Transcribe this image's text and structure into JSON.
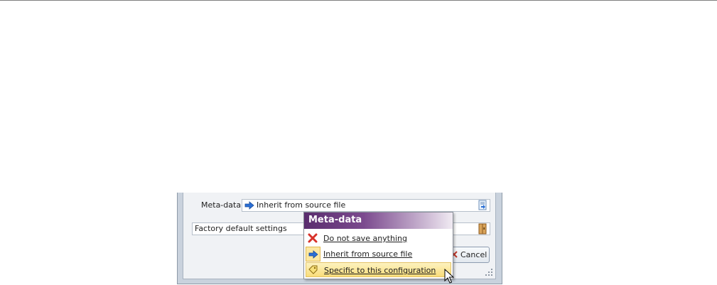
{
  "dialog": {
    "meta_label": "Meta-data",
    "meta_value": "Inherit from source file",
    "factory_value": "Factory default settings",
    "cancel_label": "Cancel"
  },
  "popup": {
    "title": "Meta-data",
    "items": [
      {
        "label": "Do not save anything",
        "icon": "red-x-icon"
      },
      {
        "label": "Inherit from source file",
        "icon": "blue-arrow-icon",
        "current": true
      },
      {
        "label": "Specific to this configuration",
        "icon": "tag-icon",
        "hovered": true
      }
    ]
  },
  "colors": {
    "popup_title": "#5a2d6e",
    "hover": "#f9dd7a",
    "arrow": "#2a6fd6"
  }
}
